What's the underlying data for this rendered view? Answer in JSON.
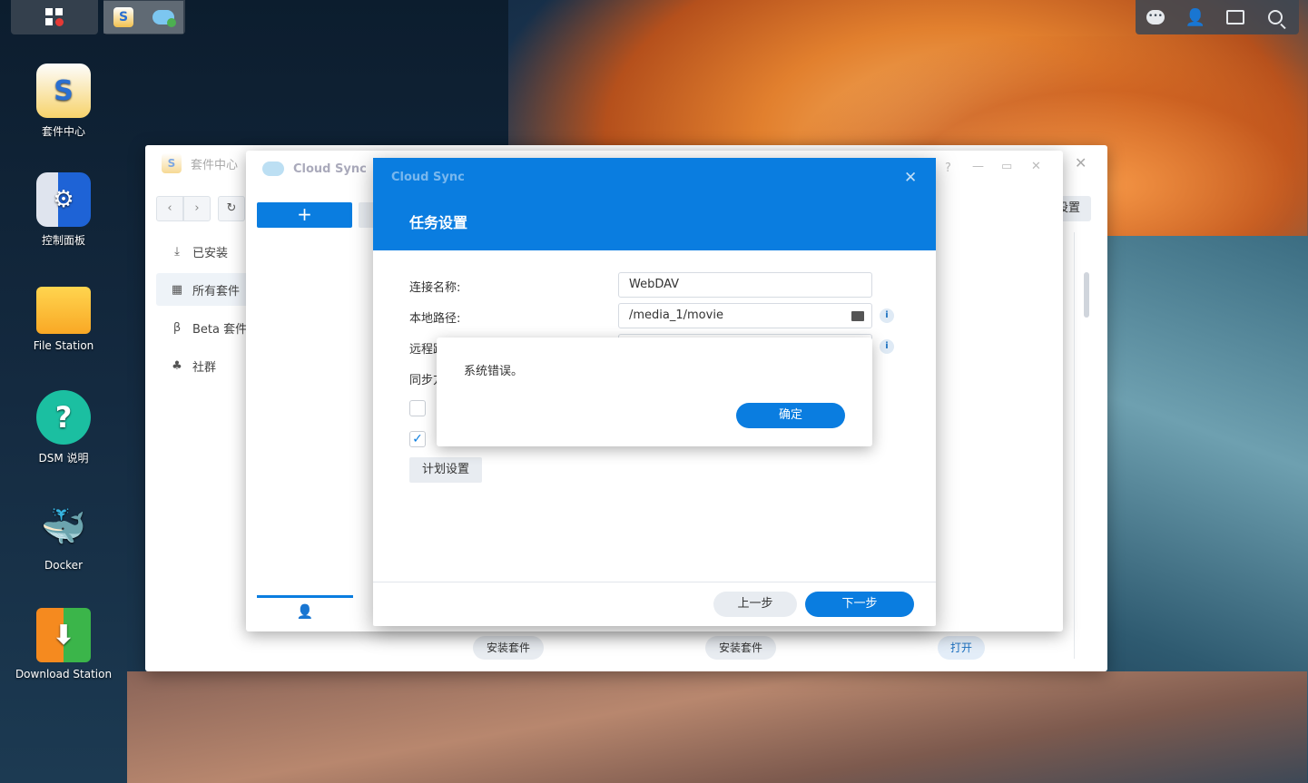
{
  "taskbar": {
    "left_buttons": [
      {
        "icon": "main-menu-icon"
      },
      {
        "icon": "package-center-icon"
      },
      {
        "icon": "cloud-sync-icon"
      }
    ],
    "right_buttons": [
      {
        "icon": "notification-chat-icon"
      },
      {
        "icon": "user-icon"
      },
      {
        "icon": "widgets-icon"
      },
      {
        "icon": "search-icon"
      }
    ]
  },
  "desktop": {
    "icons": [
      {
        "label": "套件中心",
        "icon": "package-center-icon",
        "glyph": "S"
      },
      {
        "label": "控制面板",
        "icon": "control-panel-icon",
        "glyph": "⚙"
      },
      {
        "label": "File Station",
        "icon": "folder-icon",
        "glyph": ""
      },
      {
        "label": "DSM 说明",
        "icon": "help-icon",
        "glyph": "?"
      },
      {
        "label": "Docker",
        "icon": "docker-icon",
        "glyph": "🐳"
      },
      {
        "label": "Download Station",
        "icon": "download-icon",
        "glyph": "⬇"
      }
    ]
  },
  "package_center": {
    "title": "套件中心",
    "sidebar": [
      {
        "label": "已安装",
        "icon": "download-icon"
      },
      {
        "label": "所有套件",
        "icon": "grid-icon"
      },
      {
        "label": "Beta 套件",
        "icon": "beta-icon"
      },
      {
        "label": "社群",
        "icon": "community-icon"
      }
    ],
    "settings_label": "设置",
    "bottom_buttons": [
      "安装套件",
      "安装套件",
      "打开"
    ]
  },
  "cloud_sync": {
    "title": "Cloud Sync",
    "add_label": "+"
  },
  "task_dialog": {
    "app_name": "Cloud Sync",
    "title": "任务设置",
    "fields": {
      "connection_name_label": "连接名称:",
      "connection_name_value": "WebDAV",
      "local_path_label": "本地路径:",
      "local_path_value": "/media_1/movie",
      "remote_path_label": "远程路径:",
      "sync_direction_label": "同步方向:"
    },
    "schedule_button": "计划设置",
    "prev_button": "上一步",
    "next_button": "下一步"
  },
  "error_dialog": {
    "message": "系统错误。",
    "ok_button": "确定"
  },
  "colors": {
    "accent": "#0a7de0",
    "dialog_header": "#0a7de0"
  }
}
